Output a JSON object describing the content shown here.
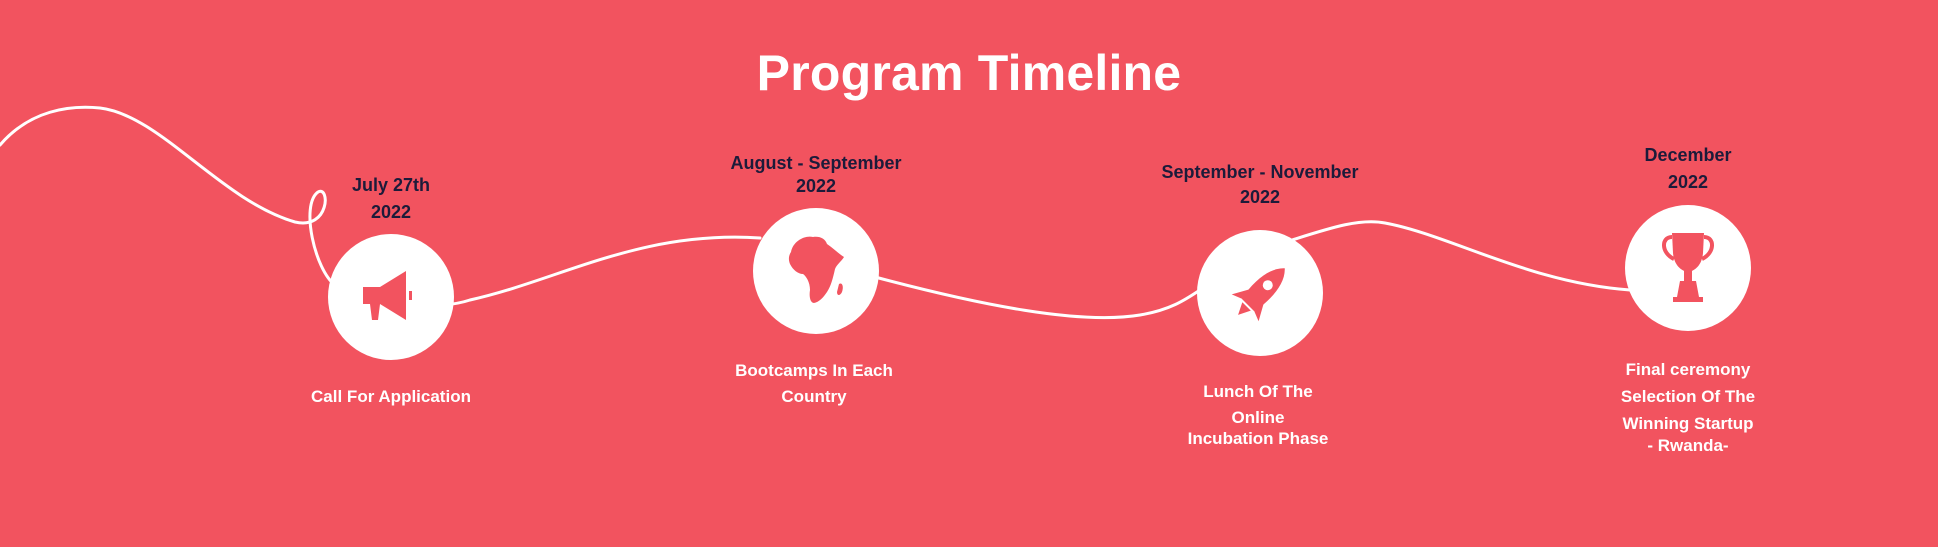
{
  "title": "Program Timeline",
  "colors": {
    "background": "#f2535f",
    "accent": "#ffffff",
    "date_text": "#1c1b3a"
  },
  "milestones": [
    {
      "date_line1": "July 27th",
      "date_line2": "2022",
      "icon": "megaphone-icon",
      "label_lines": [
        "Call For Application"
      ]
    },
    {
      "date_line1": "August - September",
      "date_line2": "2022",
      "icon": "africa-map-icon",
      "label_lines": [
        "Bootcamps In Each",
        "Country"
      ]
    },
    {
      "date_line1": "September - November",
      "date_line2": "2022",
      "icon": "rocket-icon",
      "label_lines": [
        "Lunch Of The",
        "Online",
        "Incubation Phase"
      ]
    },
    {
      "date_line1": "December",
      "date_line2": "2022",
      "icon": "trophy-icon",
      "label_lines": [
        "Final ceremony",
        "Selection Of The",
        "Winning Startup",
        "- Rwanda-"
      ]
    }
  ]
}
